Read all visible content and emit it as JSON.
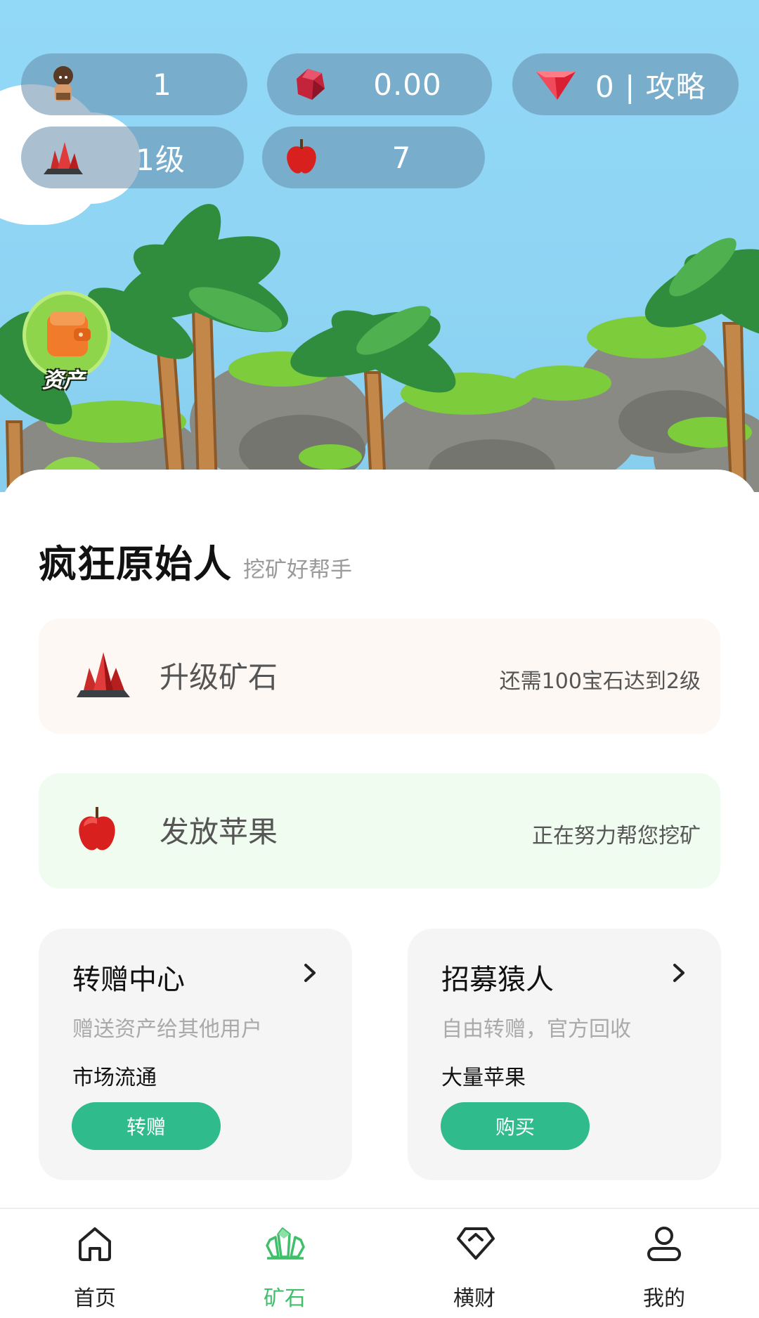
{
  "stats": {
    "characters": {
      "value": "1",
      "icon": "caveman-icon"
    },
    "gems": {
      "value": "0.00",
      "icon": "ruby-icon"
    },
    "guide": {
      "value": "0 | 攻略",
      "icon": "red-gem-icon"
    },
    "ore_level": {
      "value": "1级",
      "icon": "red-crystal-icon"
    },
    "apples": {
      "value": "7",
      "icon": "apple-icon"
    }
  },
  "asset_button": {
    "label": "资产",
    "icon": "wallet-icon"
  },
  "header": {
    "title": "疯狂原始人",
    "subtitle": "挖矿好帮手"
  },
  "upgrade_card": {
    "title": "升级矿石",
    "note": "还需100宝石达到2级"
  },
  "apple_card": {
    "title": "发放苹果",
    "note": "正在努力帮您挖矿"
  },
  "transfer_card": {
    "title": "转赠中心",
    "desc": "赠送资产给其他用户",
    "tag": "市场流通",
    "button": "转赠"
  },
  "recruit_card": {
    "title": "招募猿人",
    "desc": "自由转赠，官方回收",
    "tag": "大量苹果",
    "button": "购买"
  },
  "tabbar": {
    "items": [
      {
        "label": "首页",
        "icon": "home-icon",
        "active": false
      },
      {
        "label": "矿石",
        "icon": "crystal-icon",
        "active": true
      },
      {
        "label": "横财",
        "icon": "diamond-icon",
        "active": false
      },
      {
        "label": "我的",
        "icon": "user-icon",
        "active": false
      }
    ]
  },
  "colors": {
    "sky": "#92d8f7",
    "accent_green": "#2fbb8c",
    "active_tab": "#3fbf6a",
    "upgrade_card_bg": "#fdf8f3",
    "apple_card_bg": "#effcef"
  }
}
